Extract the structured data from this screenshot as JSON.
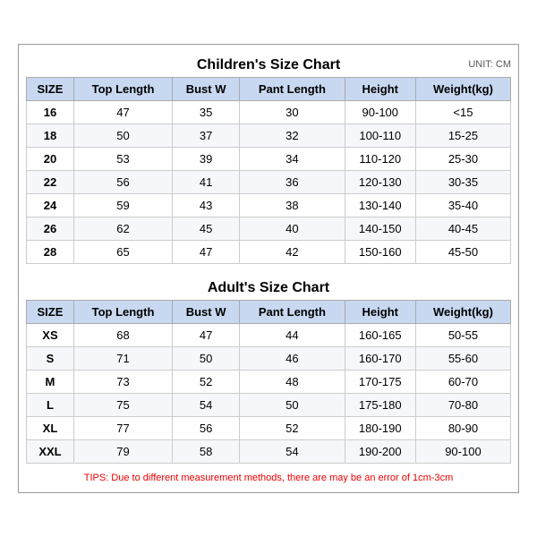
{
  "children_section": {
    "title": "Children's Size Chart",
    "unit": "UNIT: CM",
    "headers": [
      "SIZE",
      "Top Length",
      "Bust W",
      "Pant Length",
      "Height",
      "Weight(kg)"
    ],
    "rows": [
      [
        "16",
        "47",
        "35",
        "30",
        "90-100",
        "<15"
      ],
      [
        "18",
        "50",
        "37",
        "32",
        "100-110",
        "15-25"
      ],
      [
        "20",
        "53",
        "39",
        "34",
        "110-120",
        "25-30"
      ],
      [
        "22",
        "56",
        "41",
        "36",
        "120-130",
        "30-35"
      ],
      [
        "24",
        "59",
        "43",
        "38",
        "130-140",
        "35-40"
      ],
      [
        "26",
        "62",
        "45",
        "40",
        "140-150",
        "40-45"
      ],
      [
        "28",
        "65",
        "47",
        "42",
        "150-160",
        "45-50"
      ]
    ]
  },
  "adults_section": {
    "title": "Adult's Size Chart",
    "headers": [
      "SIZE",
      "Top Length",
      "Bust W",
      "Pant Length",
      "Height",
      "Weight(kg)"
    ],
    "rows": [
      [
        "XS",
        "68",
        "47",
        "44",
        "160-165",
        "50-55"
      ],
      [
        "S",
        "71",
        "50",
        "46",
        "160-170",
        "55-60"
      ],
      [
        "M",
        "73",
        "52",
        "48",
        "170-175",
        "60-70"
      ],
      [
        "L",
        "75",
        "54",
        "50",
        "175-180",
        "70-80"
      ],
      [
        "XL",
        "77",
        "56",
        "52",
        "180-190",
        "80-90"
      ],
      [
        "XXL",
        "79",
        "58",
        "54",
        "190-200",
        "90-100"
      ]
    ]
  },
  "tips": "TIPS: Due to different measurement methods, there are may be an error of 1cm-3cm"
}
